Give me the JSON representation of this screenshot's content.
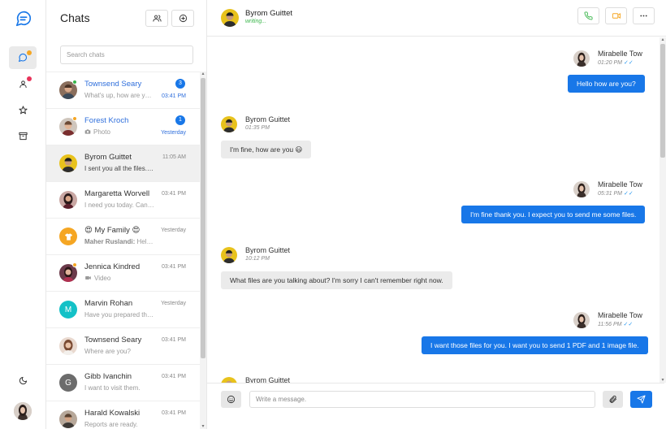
{
  "colors": {
    "accent": "#1877e8",
    "online": "#39b54a",
    "away": "#f5a623",
    "alert": "#e8325a"
  },
  "rail": {
    "items": [
      {
        "icon": "chat-bubble-icon",
        "active": true,
        "dot": "#f5a623"
      },
      {
        "icon": "user-icon",
        "active": false,
        "dot": "#e8325a"
      },
      {
        "icon": "star-icon",
        "active": false
      },
      {
        "icon": "archive-icon",
        "active": false
      }
    ],
    "bottom": {
      "icon": "moon-icon"
    }
  },
  "list": {
    "title": "Chats",
    "search_placeholder": "Search chats",
    "items": [
      {
        "name": "Townsend Seary",
        "preview": "What's up, how are you?",
        "time": "03:41 PM",
        "unread": "3",
        "highlight": true
      },
      {
        "name": "Forest Kroch",
        "preview": "Photo",
        "time": "Yesterday",
        "unread": "1",
        "highlight": true
      },
      {
        "name": "Byrom Guittet",
        "preview": "I sent you all the files. Good luck with 😃",
        "time": "11:05 AM",
        "selected": true
      },
      {
        "name": "Margaretta Worvell",
        "preview": "I need you today. Can you come with me?",
        "time": "03:41 PM"
      },
      {
        "name": "😍 My Family 😍",
        "preview_author": "Maher Ruslandi:",
        "preview": " Hello!!!",
        "time": "Yesterday"
      },
      {
        "name": "Jennica Kindred",
        "preview": "Video",
        "time": "03:41 PM"
      },
      {
        "name": "Marvin Rohan",
        "preview": "Have you prepared the files?",
        "time": "Yesterday",
        "initial": "M"
      },
      {
        "name": "Townsend Seary",
        "preview": "Where are you?",
        "time": "03:41 PM"
      },
      {
        "name": "Gibb Ivanchin",
        "preview": "I want to visit them.",
        "time": "03:41 PM",
        "initial": "G"
      },
      {
        "name": "Harald Kowalski",
        "preview": "Reports are ready.",
        "time": "03:41 PM"
      }
    ]
  },
  "conversation": {
    "name": "Byrom Guittet",
    "status": "writing...",
    "messages": [
      {
        "side": "out",
        "name": "Mirabelle Tow",
        "time": "01:20 PM",
        "text": "Hello how are you?"
      },
      {
        "side": "in",
        "name": "Byrom Guittet",
        "time": "01:35 PM",
        "text": "I'm fine, how are you 😃"
      },
      {
        "side": "out",
        "name": "Mirabelle Tow",
        "time": "05:31 PM",
        "text": "I'm fine thank you. I expect you to send me some files."
      },
      {
        "side": "in",
        "name": "Byrom Guittet",
        "time": "10:12 PM",
        "text": "What files are you talking about? I'm sorry I can't remember right now."
      },
      {
        "side": "out",
        "name": "Mirabelle Tow",
        "time": "11:56 PM",
        "text": "I want those files for you. I want you to send 1 PDF and 1 image file."
      },
      {
        "side": "in",
        "name": "Byrom Guittet"
      }
    ],
    "ticks": "✓✓",
    "composer_placeholder": "Write a message."
  }
}
